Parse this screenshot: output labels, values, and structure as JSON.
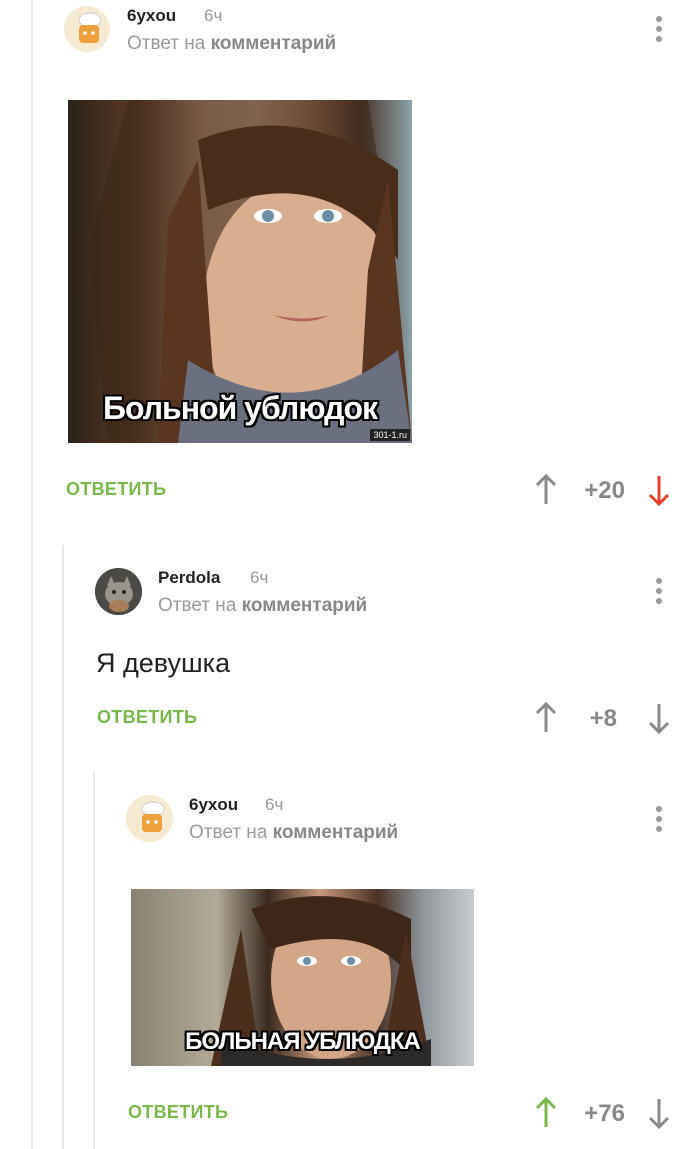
{
  "comments": [
    {
      "username": "6yxou",
      "time": "6ч",
      "reply_prefix": "Ответ на",
      "reply_link": "комментарий",
      "image_caption": "Больной ублюдок",
      "image_watermark": "301-1.ru",
      "reply_label": "ОТВЕТИТЬ",
      "score": "+20",
      "vote_state": "down",
      "avatar_icon": "chef-avatar"
    },
    {
      "username": "Perdola",
      "time": "6ч",
      "reply_prefix": "Ответ на",
      "reply_link": "комментарий",
      "text": "Я девушка",
      "reply_label": "ОТВЕТИТЬ",
      "score": "+8",
      "vote_state": "none",
      "avatar_icon": "cat-avatar"
    },
    {
      "username": "6yxou",
      "time": "6ч",
      "reply_prefix": "Ответ на",
      "reply_link": "комментарий",
      "image_caption": "БОЛЬНАЯ УБЛЮДКА",
      "reply_label": "ОТВЕТИТЬ",
      "score": "+76",
      "vote_state": "up",
      "avatar_icon": "chef-avatar"
    }
  ],
  "colors": {
    "reply_green": "#7ab84a",
    "vote_up_active": "#7ab84a",
    "vote_down_active": "#e6402a",
    "vote_inactive": "#8a8a8a"
  }
}
